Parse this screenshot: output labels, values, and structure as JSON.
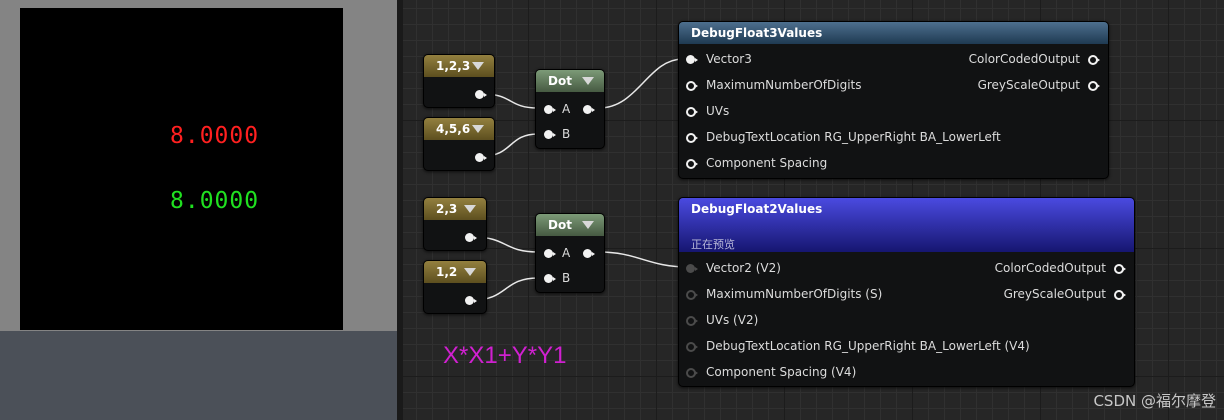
{
  "preview": {
    "values": [
      {
        "text": "8.0000",
        "color": "#ff2020"
      },
      {
        "text": "8.0000",
        "color": "#20e020"
      }
    ]
  },
  "nodes": {
    "const_a1": {
      "title": "1,2,3"
    },
    "const_b1": {
      "title": "4,5,6"
    },
    "const_a2": {
      "title": "2,3"
    },
    "const_b2": {
      "title": "1,2"
    },
    "dot1": {
      "title": "Dot",
      "pins": [
        "A",
        "B"
      ]
    },
    "dot2": {
      "title": "Dot",
      "pins": [
        "A",
        "B"
      ]
    },
    "debug3": {
      "title": "DebugFloat3Values",
      "inputs": [
        "Vector3",
        "MaximumNumberOfDigits",
        "UVs",
        "DebugTextLocation RG_UpperRight BA_LowerLeft",
        "Component Spacing"
      ],
      "outputs": [
        "ColorCodedOutput",
        "GreyScaleOutput"
      ]
    },
    "debug2": {
      "title": "DebugFloat2Values",
      "subtitle": "正在预览",
      "inputs": [
        "Vector2 (V2)",
        "MaximumNumberOfDigits (S)",
        "UVs (V2)",
        "DebugTextLocation RG_UpperRight BA_LowerLeft (V4)",
        "Component Spacing (V4)"
      ],
      "outputs": [
        "ColorCodedOutput",
        "GreyScaleOutput"
      ]
    }
  },
  "comment": "X*X1+Y*Y1",
  "watermark": "CSDN @福尔摩登",
  "colors": {
    "const_header": "#93803f",
    "dot_header": "#7c9a77",
    "debug3_header": "#4d6f8e",
    "debug2_header": "#3434c8",
    "comment": "#d020d0"
  }
}
